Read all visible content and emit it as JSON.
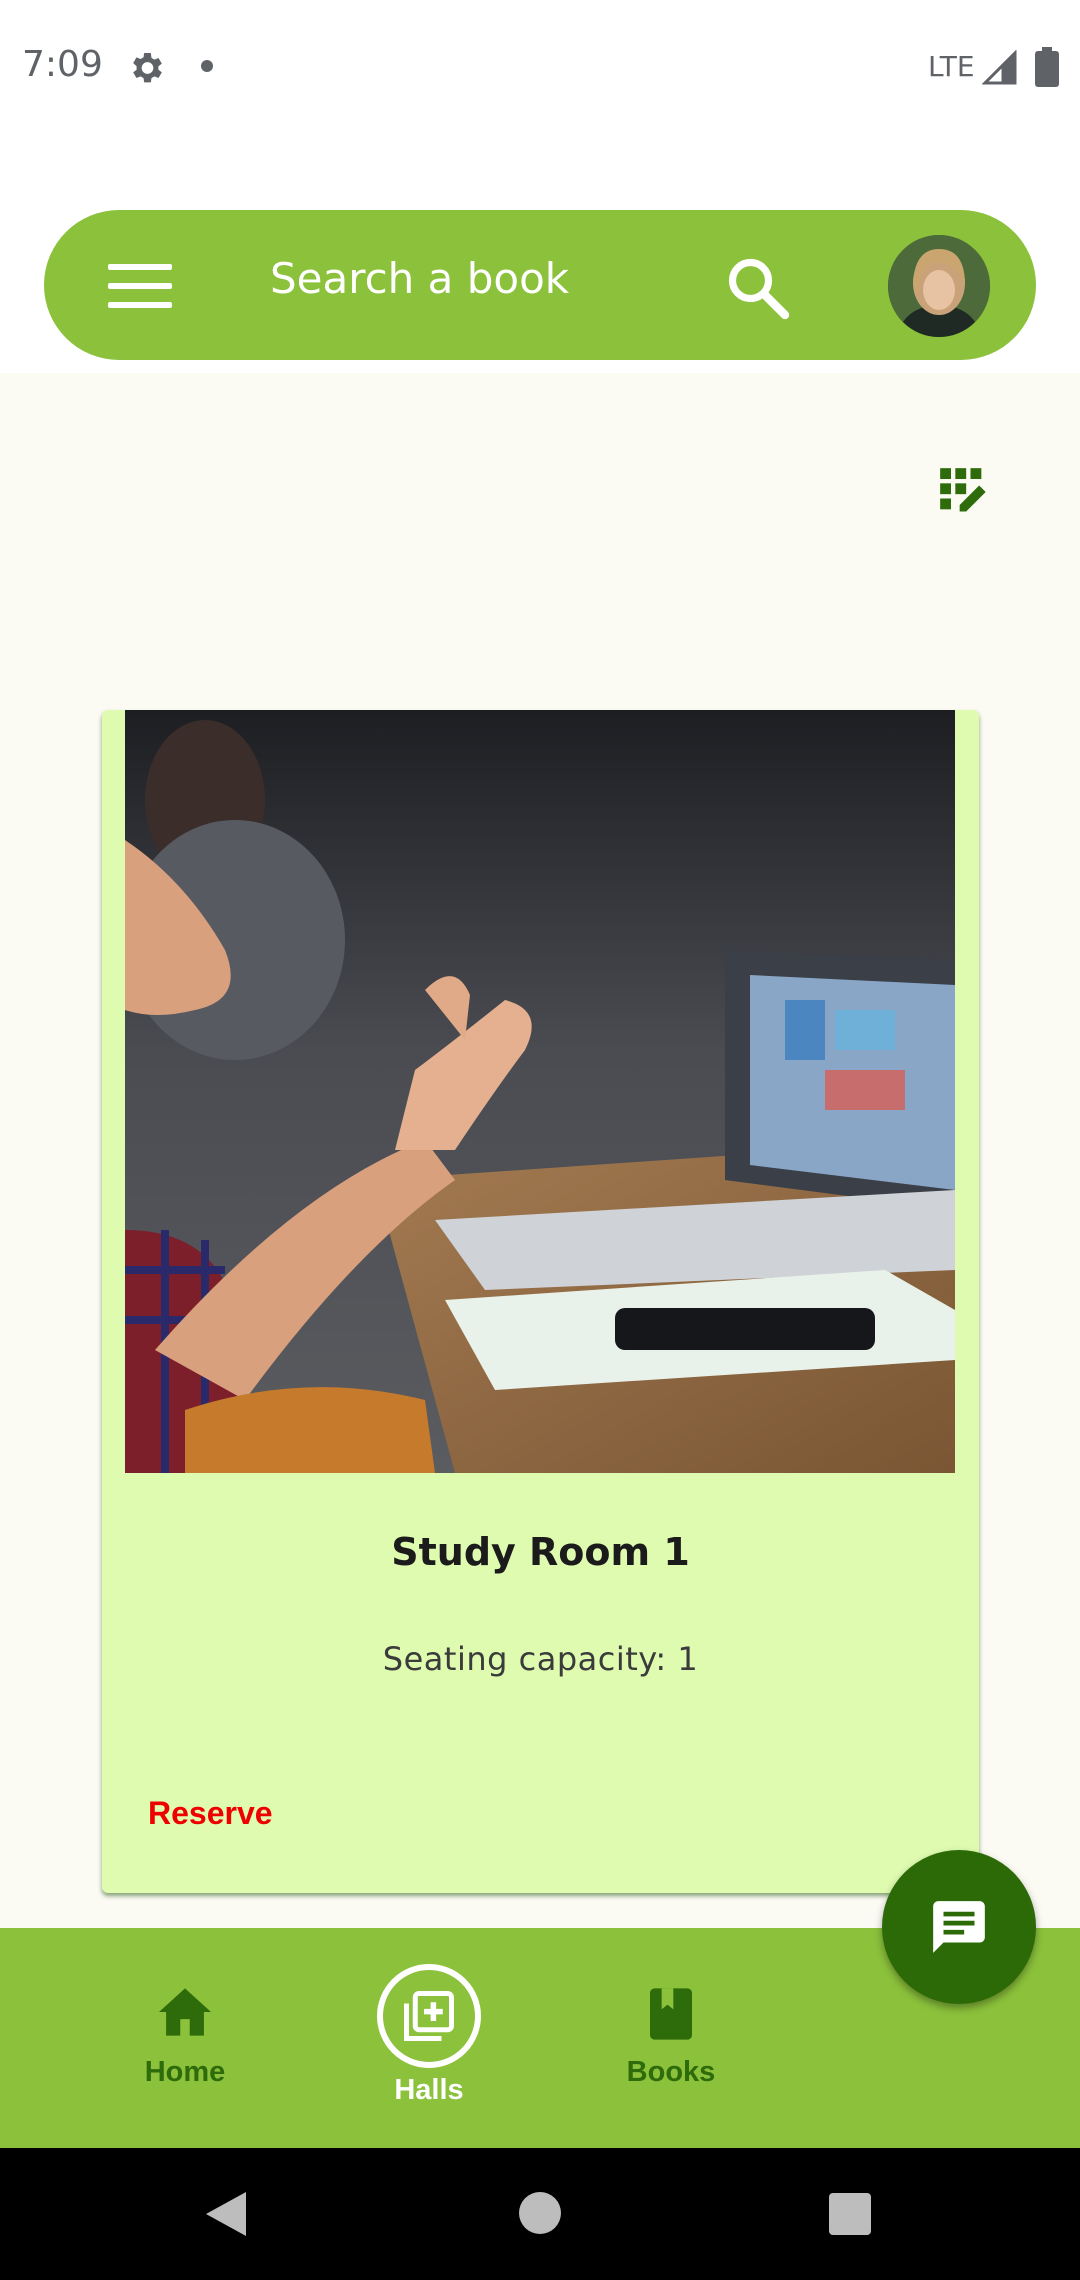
{
  "status_bar": {
    "time": "7:09",
    "network": "LTE",
    "icons": [
      "gear-icon",
      "notification-dot",
      "signal-icon",
      "battery-icon"
    ]
  },
  "search": {
    "placeholder": "Search a book",
    "icons": [
      "menu-icon",
      "search-icon",
      "avatar"
    ]
  },
  "toolbar": {
    "icons": [
      "grid-edit-icon"
    ]
  },
  "room_card": {
    "title": "Study Room 1",
    "capacity_text": "Seating capacity: 1",
    "reserve_label": "Reserve"
  },
  "bottom_nav": {
    "items": [
      {
        "label": "Home",
        "icon": "home-icon",
        "active": false
      },
      {
        "label": "Halls",
        "icon": "library-add-icon",
        "active": true
      },
      {
        "label": "Books",
        "icon": "book-icon",
        "active": false
      }
    ]
  },
  "fab": {
    "icon": "chat-icon"
  },
  "colors": {
    "primary": "#8bc13b",
    "dark_green": "#2c6a08",
    "inactive_nav": "#2e6b0a",
    "card_bg": "#defbb0",
    "page_bg": "#fbfaf3",
    "reserve": "#ee0000"
  }
}
